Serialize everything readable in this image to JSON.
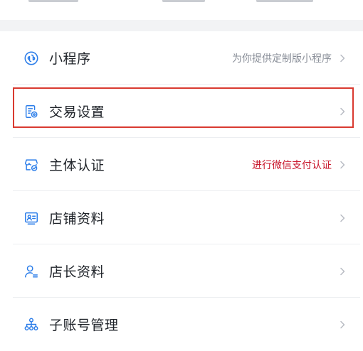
{
  "menu": {
    "items": [
      {
        "label": "小程序",
        "hint": "为你提供定制版小程序",
        "icon": "mini-program-icon"
      },
      {
        "label": "交易设置",
        "hint": "",
        "icon": "transaction-settings-icon",
        "highlighted": true
      },
      {
        "label": "主体认证",
        "hint": "进行微信支付认证",
        "icon": "entity-verification-icon",
        "hint_color": "#c8162b"
      },
      {
        "label": "店铺资料",
        "hint": "",
        "icon": "store-profile-icon"
      },
      {
        "label": "店长资料",
        "hint": "",
        "icon": "manager-profile-icon"
      },
      {
        "label": "子账号管理",
        "hint": "",
        "icon": "sub-account-icon"
      }
    ]
  },
  "colors": {
    "icon": "#2b7de9",
    "highlight_border": "#d93a30",
    "hint": "#8a8f99",
    "hint_red": "#c8162b"
  }
}
